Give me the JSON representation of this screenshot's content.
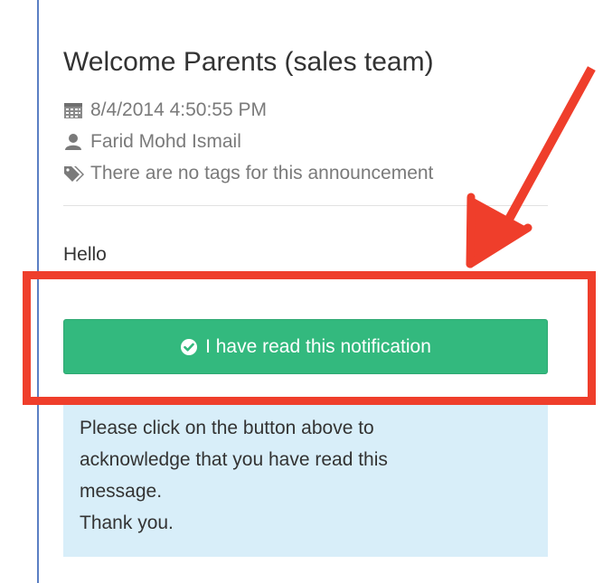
{
  "announcement": {
    "title": "Welcome Parents (sales team)",
    "date": "8/4/2014 4:50:55 PM",
    "author": "Farid Mohd Ismail",
    "tags": "There are no tags for this announcement",
    "body": "Hello"
  },
  "acknowledge": {
    "button_label": "I have read this notification"
  },
  "info_box": {
    "lines": [
      "Please click on the button above to",
      "acknowledge that you have read this",
      "message.",
      "Thank you."
    ]
  },
  "icons": {
    "date": "calendar-icon",
    "author": "user-icon",
    "tags": "tags-icon",
    "button": "check-circle-icon"
  },
  "colors": {
    "button": "#33b97e",
    "info_background": "#d8eef9",
    "highlight": "#ef3e2b",
    "left_rule": "#5b7fc4"
  }
}
